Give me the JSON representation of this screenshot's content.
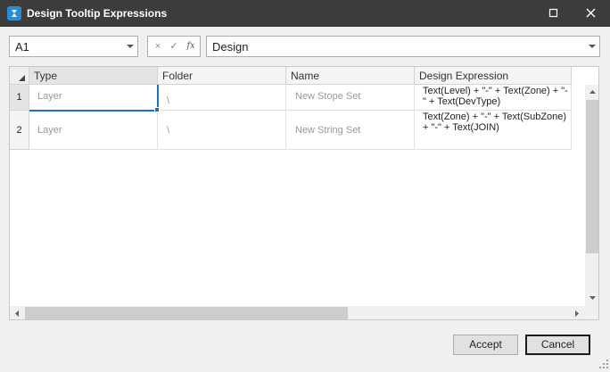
{
  "window": {
    "title": "Design Tooltip Expressions"
  },
  "formula_bar": {
    "cell_reference": "A1",
    "formula_value": "Design",
    "cancel_symbol": "×",
    "confirm_symbol": "✓",
    "function_symbol": "fx"
  },
  "grid": {
    "columns": [
      "Type",
      "Folder",
      "Name",
      "Design Expression"
    ],
    "rows": [
      {
        "number": "1",
        "type": "Layer",
        "folder": "\\",
        "name": "New Stope Set",
        "expression": "Text(Level) + \"-\" + Text(Zone) + \"-\" + Text(DevType)"
      },
      {
        "number": "2",
        "type": "Layer",
        "folder": "\\",
        "name": "New String Set",
        "expression": "Text(Zone) + \"-\" + Text(SubZone) + \"-\" + Text(JOIN)"
      }
    ]
  },
  "buttons": {
    "accept": "Accept",
    "cancel": "Cancel"
  },
  "icons": {
    "app": "app-logo-icon",
    "maximize": "maximize-icon",
    "close": "close-icon",
    "dropdown": "chevron-down-icon",
    "select_all": "select-all-triangle-icon",
    "scroll_up": "scroll-up-icon",
    "scroll_down": "scroll-down-icon",
    "scroll_left": "scroll-left-icon",
    "scroll_right": "scroll-right-icon",
    "resize_grip": "resize-grip-icon"
  },
  "colors": {
    "titlebar": "#3c3c3c",
    "selection": "#1f6fc5",
    "app_icon": "#2a8dd4"
  }
}
